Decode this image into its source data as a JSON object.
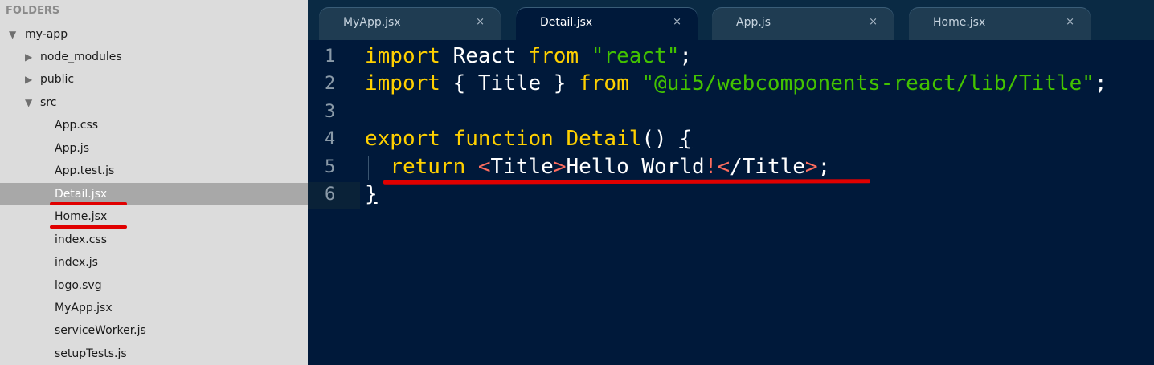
{
  "sidebar": {
    "header": "FOLDERS",
    "tree": [
      {
        "label": "my-app",
        "arrow": "▼"
      },
      {
        "label": "node_modules",
        "arrow": "▶"
      },
      {
        "label": "public",
        "arrow": "▶"
      },
      {
        "label": "src",
        "arrow": "▼"
      },
      {
        "label": "App.css"
      },
      {
        "label": "App.js"
      },
      {
        "label": "App.test.js"
      },
      {
        "label": "Detail.jsx",
        "selected": true
      },
      {
        "label": "Home.jsx"
      },
      {
        "label": "index.css"
      },
      {
        "label": "index.js"
      },
      {
        "label": "logo.svg"
      },
      {
        "label": "MyApp.jsx"
      },
      {
        "label": "serviceWorker.js"
      },
      {
        "label": "setupTests.js"
      }
    ]
  },
  "tabs": [
    {
      "label": "MyApp.jsx",
      "close": "×"
    },
    {
      "label": "Detail.jsx",
      "close": "×",
      "active": true
    },
    {
      "label": "App.js",
      "close": "×"
    },
    {
      "label": "Home.jsx",
      "close": "×"
    }
  ],
  "editor": {
    "line_numbers": [
      "1",
      "2",
      "3",
      "4",
      "5",
      "6"
    ],
    "current_line": "6",
    "lines": {
      "l1": {
        "import": "import",
        "t1": " React ",
        "from": "from",
        "t2": " ",
        "str": "\"react\"",
        "t3": ";"
      },
      "l2": {
        "import": "import",
        "t1": " { Title } ",
        "from": "from",
        "t2": " ",
        "str": "\"@ui5/webcomponents-react/lib/Title\"",
        "t3": ";"
      },
      "l4": {
        "export": "export",
        "t1": " ",
        "function": "function",
        "t2": " ",
        "name": "Detail",
        "t3": "() ",
        "brace": "{"
      },
      "l5": {
        "indent": "  ",
        "ret": "return",
        "t1": " ",
        "lt": "<",
        "tag1": "Title",
        "gt": ">",
        "text": "Hello World",
        "bang": "!",
        "lt2": "<",
        "tag2": "/Title",
        "gt2": ">",
        "t2": ";"
      },
      "l6": {
        "brace": "}"
      }
    }
  },
  "colors": {
    "keyword": "#ffd000",
    "string": "#43c300",
    "tag_bracket": "#ff6d5e",
    "editor_bg": "#00193a",
    "annotation_red": "#e00000"
  }
}
